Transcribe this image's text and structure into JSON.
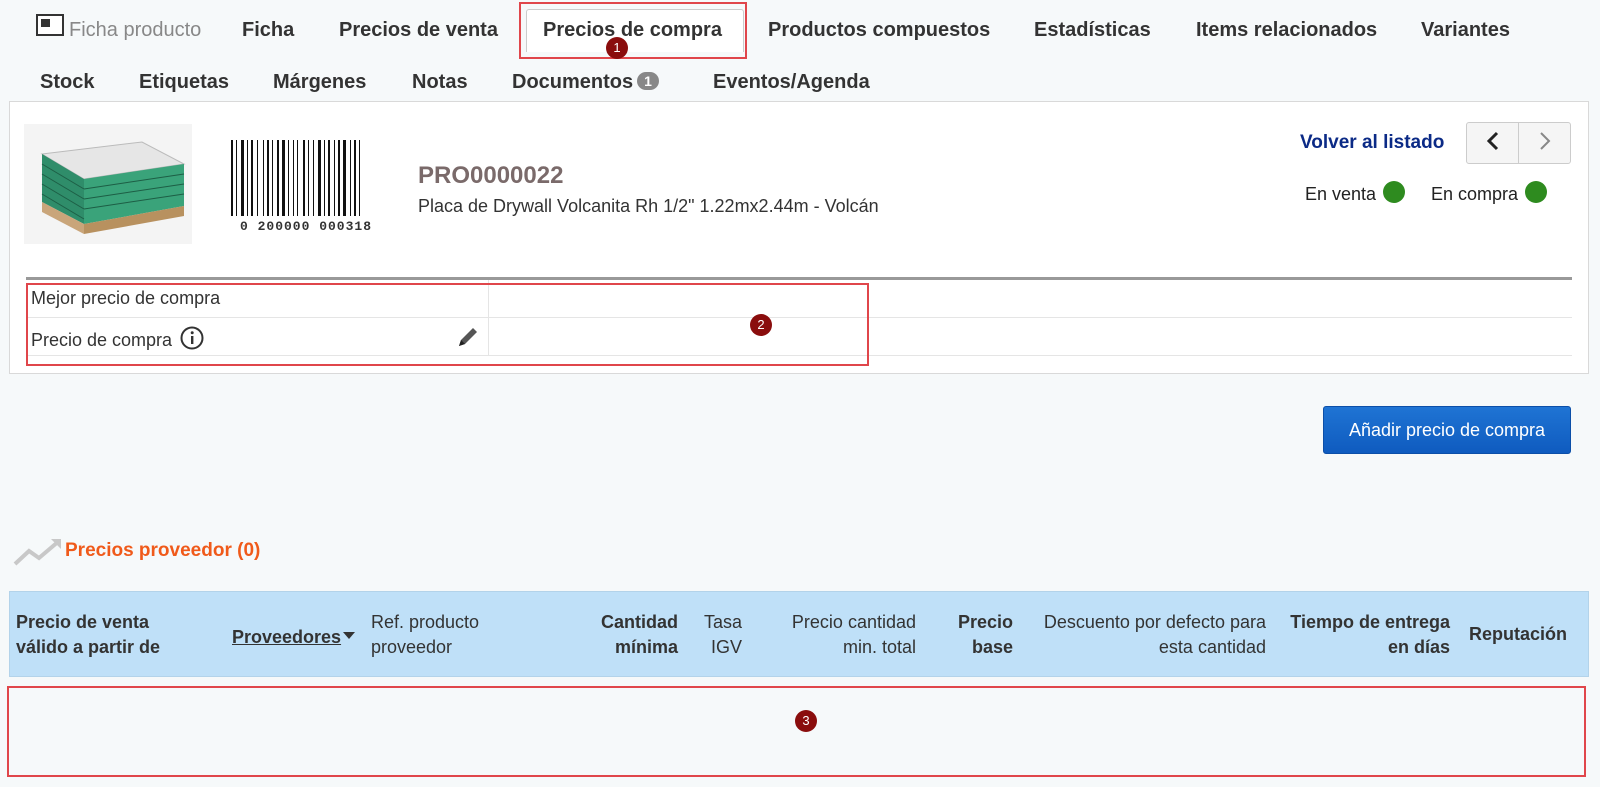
{
  "tabs": {
    "row1": [
      "Ficha producto",
      "Ficha",
      "Precios de venta",
      "Precios de compra",
      "Productos compuestos",
      "Estadísticas",
      "Items relacionados",
      "Variantes"
    ],
    "row2": [
      "Stock",
      "Etiquetas",
      "Márgenes",
      "Notas",
      "Documentos",
      "Eventos/Agenda"
    ],
    "documentos_count": "1",
    "active": "Precios de compra"
  },
  "markers": [
    "1",
    "2",
    "3"
  ],
  "product": {
    "ref": "PRO0000022",
    "label": "Placa de Drywall Volcanita Rh 1/2\" 1.22mx2.44m - Volcán",
    "barcode_text": "0 200000 000318",
    "image_icon": "drywall-sheets-image"
  },
  "nav": {
    "back_link": "Volver al listado",
    "prev_icon": "chevron-left-icon",
    "next_icon": "chevron-right-icon"
  },
  "status": {
    "on_sale_label": "En venta",
    "on_purchase_label": "En compra",
    "color": "#2e8b1f"
  },
  "price_fields": {
    "best_price_label": "Mejor precio de compra",
    "price_label": "Precio de compra",
    "best_price_value": "",
    "price_value": ""
  },
  "add_button_label": "Añadir precio de compra",
  "supplier_prices": {
    "title": "Precios proveedor (0)",
    "columns": [
      [
        "Precio de venta",
        "válido a partir de"
      ],
      [
        "Proveedores"
      ],
      [
        "Ref. producto",
        "proveedor"
      ],
      [
        "Cantidad",
        "mínima"
      ],
      [
        "Tasa",
        "IGV"
      ],
      [
        "Precio cantidad",
        "min. total"
      ],
      [
        "Precio",
        "base"
      ],
      [
        "Descuento por defecto para",
        "esta cantidad"
      ],
      [
        "Tiempo de entrega",
        "en días"
      ],
      [
        "Reputación"
      ]
    ],
    "rows": []
  },
  "colors": {
    "accent": "#0f5bbf",
    "section_title": "#f05a1a",
    "header_bg": "#bfe0f8",
    "highlight_box": "#e0464b",
    "marker_bg": "#8a0d0d"
  }
}
